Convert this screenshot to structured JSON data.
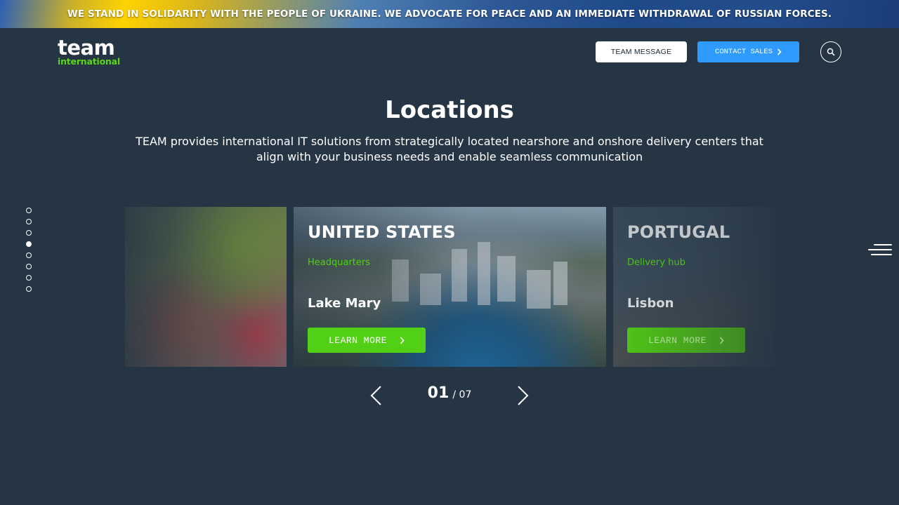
{
  "banner": {
    "text": "WE STAND IN SOLIDARITY WITH THE PEOPLE OF UKRAINE. WE ADVOCATE FOR PEACE AND AN IMMEDIATE WITHDRAWAL OF RUSSIAN FORCES."
  },
  "header": {
    "logo_top": "team",
    "logo_bottom": "international",
    "message_button": "TEAM MESSAGE",
    "sales_button": "CONTACT SALES",
    "search_icon": "search-icon"
  },
  "section": {
    "title": "Locations",
    "description": "TEAM provides international IT solutions from strategically located nearshore and onshore delivery centers that align with your business needs and enable seamless communication"
  },
  "side_nav": {
    "dot_count": 8,
    "active_index": 3
  },
  "cards": {
    "main": {
      "country": "UNITED STATES",
      "role": "Headquarters",
      "city": "Lake Mary",
      "button": "LEARN MORE"
    },
    "next": {
      "country": "PORTUGAL",
      "role": "Delivery hub",
      "city": "Lisbon",
      "button": "LEARN MORE"
    }
  },
  "pager": {
    "current": "01",
    "total": "07"
  },
  "colors": {
    "background": "#253544",
    "accent_green": "#52d016",
    "accent_blue": "#2f9bff"
  }
}
